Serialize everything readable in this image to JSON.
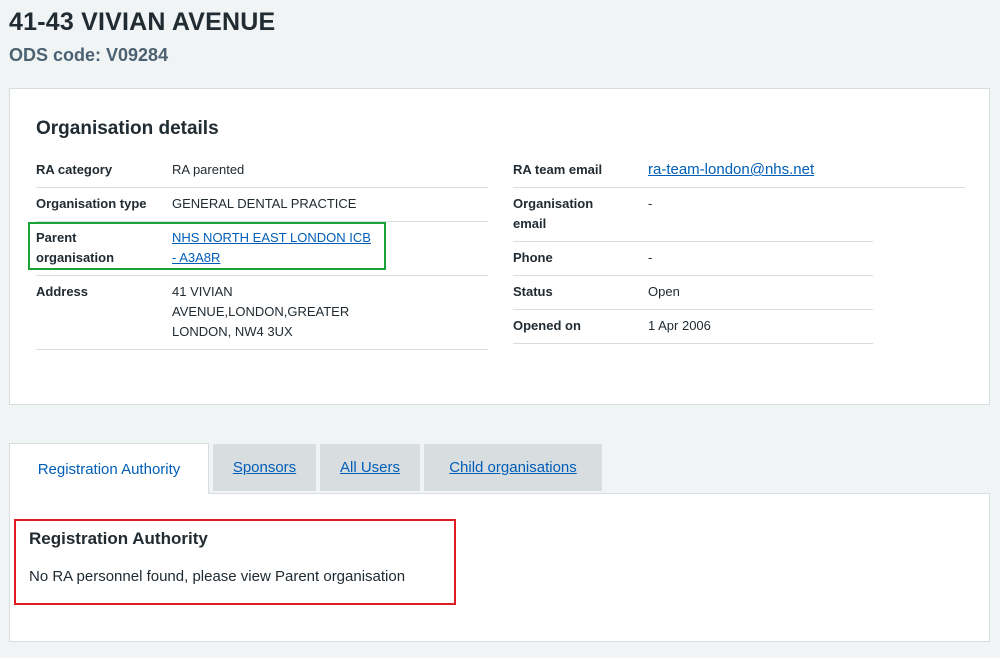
{
  "page": {
    "title": "41-43 VIVIAN AVENUE",
    "ods_code": "ODS code: V09284"
  },
  "details": {
    "heading": "Organisation details",
    "left": [
      {
        "label": "RA category",
        "value": "RA parented"
      },
      {
        "label": "Organisation type",
        "value": "GENERAL DENTAL PRACTICE"
      },
      {
        "label": "Parent organisation",
        "value": "NHS NORTH EAST LONDON ICB - A3A8R"
      },
      {
        "label": "Address",
        "value": "41 VIVIAN AVENUE,LONDON,GREATER LONDON, NW4 3UX"
      }
    ],
    "right": [
      {
        "label": "RA team email",
        "value": "ra-team-london@nhs.net"
      },
      {
        "label": "Organisation email",
        "value": "-"
      },
      {
        "label": "Phone",
        "value": "-"
      },
      {
        "label": "Status",
        "value": "Open"
      },
      {
        "label": "Opened on",
        "value": "1 Apr 2006"
      }
    ]
  },
  "tabs": [
    {
      "label": "Registration Authority",
      "active": true
    },
    {
      "label": "Sponsors",
      "active": false
    },
    {
      "label": "All Users",
      "active": false
    },
    {
      "label": "Child organisations",
      "active": false
    }
  ],
  "panel": {
    "heading": "Registration Authority",
    "message": "No RA personnel found, please view Parent organisation"
  },
  "colors": {
    "link": "#005eb8",
    "highlight_green": "#19a338",
    "highlight_red": "#e11b22"
  }
}
